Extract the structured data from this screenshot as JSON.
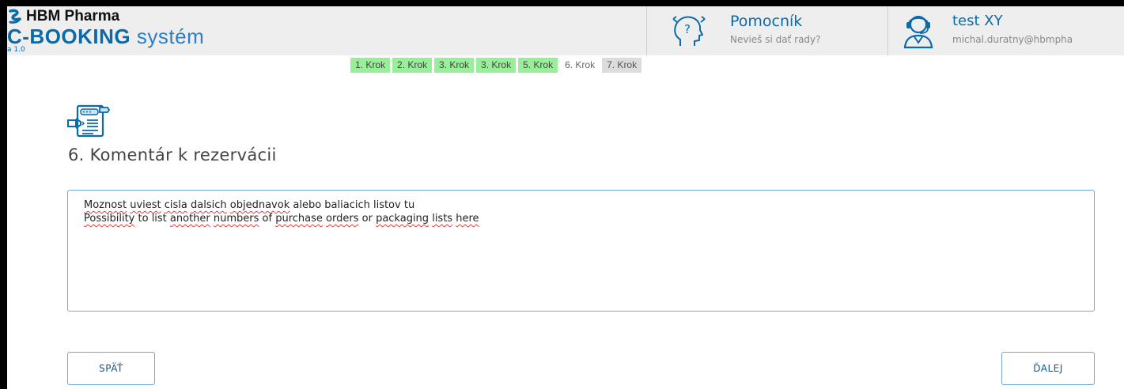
{
  "header": {
    "company": "HBM Pharma",
    "product_bold": "C-BOOKING",
    "product_light": " systém",
    "version": "a 1.0",
    "helper_title": "Pomocník",
    "helper_subtitle": "Nevieš si dať rady?",
    "user_name": "test XY",
    "user_email": "michal.duratny@hbmpha"
  },
  "steps": [
    {
      "label": "1. Krok",
      "state": "done"
    },
    {
      "label": "2. Krok",
      "state": "done"
    },
    {
      "label": "3. Krok",
      "state": "done"
    },
    {
      "label": "3. Krok",
      "state": "done"
    },
    {
      "label": "5. Krok",
      "state": "done"
    },
    {
      "label": "6. Krok",
      "state": "active"
    },
    {
      "label": "7. Krok",
      "state": "todo"
    }
  ],
  "section": {
    "title": "6. Komentár k rezervácii"
  },
  "comment": {
    "line1_words": [
      {
        "t": "Moznost",
        "sp": true
      },
      {
        "t": " ",
        "sp": false
      },
      {
        "t": "uviest",
        "sp": true
      },
      {
        "t": " ",
        "sp": false
      },
      {
        "t": "cisla",
        "sp": true
      },
      {
        "t": " ",
        "sp": false
      },
      {
        "t": "dalsich",
        "sp": true
      },
      {
        "t": " ",
        "sp": false
      },
      {
        "t": "objednavok",
        "sp": true
      },
      {
        "t": " alebo baliacich listov tu",
        "sp": false
      }
    ],
    "line2_words": [
      {
        "t": "Possibility",
        "sp": true
      },
      {
        "t": " to list ",
        "sp": false
      },
      {
        "t": "another",
        "sp": true
      },
      {
        "t": " ",
        "sp": false
      },
      {
        "t": "numbers",
        "sp": true
      },
      {
        "t": " of ",
        "sp": false
      },
      {
        "t": "purchase",
        "sp": true
      },
      {
        "t": " ",
        "sp": false
      },
      {
        "t": "orders",
        "sp": true
      },
      {
        "t": " or ",
        "sp": false
      },
      {
        "t": "packaging",
        "sp": true
      },
      {
        "t": " ",
        "sp": false
      },
      {
        "t": "lists",
        "sp": true
      },
      {
        "t": " ",
        "sp": false
      },
      {
        "t": "here",
        "sp": true
      }
    ]
  },
  "buttons": {
    "back": "SPÄŤ",
    "next": "ĎALEJ"
  },
  "colors": {
    "brand": "#0b6aa8",
    "step_done": "#99ee99",
    "step_todo": "#dcdcdc",
    "border_accent": "#6fa8dc"
  },
  "icons": {
    "helper": "head-question-icon",
    "user": "support-agent-icon",
    "section": "document-comment-icon",
    "logo": "pharma-logo-icon"
  }
}
